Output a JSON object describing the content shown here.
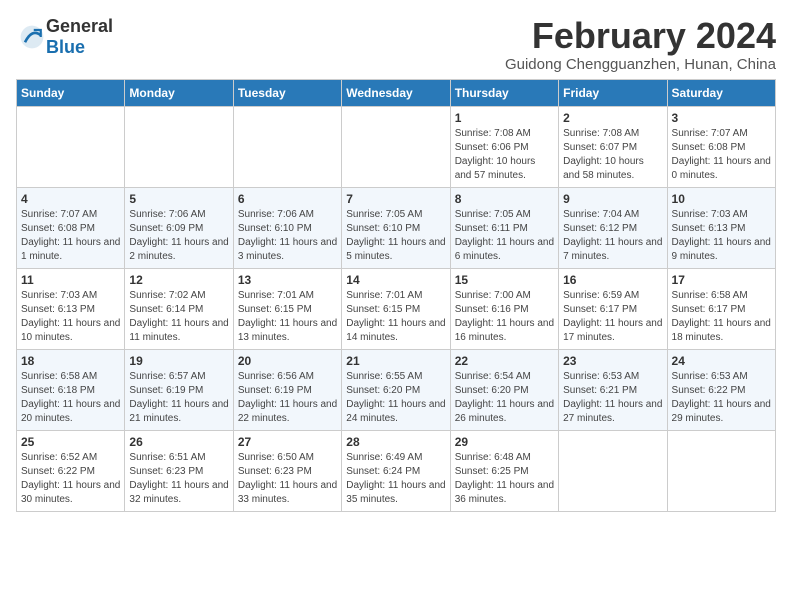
{
  "logo": {
    "general": "General",
    "blue": "Blue"
  },
  "title": "February 2024",
  "location": "Guidong Chengguanzhen, Hunan, China",
  "headers": [
    "Sunday",
    "Monday",
    "Tuesday",
    "Wednesday",
    "Thursday",
    "Friday",
    "Saturday"
  ],
  "rows": [
    [
      {
        "day": "",
        "info": ""
      },
      {
        "day": "",
        "info": ""
      },
      {
        "day": "",
        "info": ""
      },
      {
        "day": "",
        "info": ""
      },
      {
        "day": "1",
        "info": "Sunrise: 7:08 AM\nSunset: 6:06 PM\nDaylight: 10 hours and 57 minutes."
      },
      {
        "day": "2",
        "info": "Sunrise: 7:08 AM\nSunset: 6:07 PM\nDaylight: 10 hours and 58 minutes."
      },
      {
        "day": "3",
        "info": "Sunrise: 7:07 AM\nSunset: 6:08 PM\nDaylight: 11 hours and 0 minutes."
      }
    ],
    [
      {
        "day": "4",
        "info": "Sunrise: 7:07 AM\nSunset: 6:08 PM\nDaylight: 11 hours and 1 minute."
      },
      {
        "day": "5",
        "info": "Sunrise: 7:06 AM\nSunset: 6:09 PM\nDaylight: 11 hours and 2 minutes."
      },
      {
        "day": "6",
        "info": "Sunrise: 7:06 AM\nSunset: 6:10 PM\nDaylight: 11 hours and 3 minutes."
      },
      {
        "day": "7",
        "info": "Sunrise: 7:05 AM\nSunset: 6:10 PM\nDaylight: 11 hours and 5 minutes."
      },
      {
        "day": "8",
        "info": "Sunrise: 7:05 AM\nSunset: 6:11 PM\nDaylight: 11 hours and 6 minutes."
      },
      {
        "day": "9",
        "info": "Sunrise: 7:04 AM\nSunset: 6:12 PM\nDaylight: 11 hours and 7 minutes."
      },
      {
        "day": "10",
        "info": "Sunrise: 7:03 AM\nSunset: 6:13 PM\nDaylight: 11 hours and 9 minutes."
      }
    ],
    [
      {
        "day": "11",
        "info": "Sunrise: 7:03 AM\nSunset: 6:13 PM\nDaylight: 11 hours and 10 minutes."
      },
      {
        "day": "12",
        "info": "Sunrise: 7:02 AM\nSunset: 6:14 PM\nDaylight: 11 hours and 11 minutes."
      },
      {
        "day": "13",
        "info": "Sunrise: 7:01 AM\nSunset: 6:15 PM\nDaylight: 11 hours and 13 minutes."
      },
      {
        "day": "14",
        "info": "Sunrise: 7:01 AM\nSunset: 6:15 PM\nDaylight: 11 hours and 14 minutes."
      },
      {
        "day": "15",
        "info": "Sunrise: 7:00 AM\nSunset: 6:16 PM\nDaylight: 11 hours and 16 minutes."
      },
      {
        "day": "16",
        "info": "Sunrise: 6:59 AM\nSunset: 6:17 PM\nDaylight: 11 hours and 17 minutes."
      },
      {
        "day": "17",
        "info": "Sunrise: 6:58 AM\nSunset: 6:17 PM\nDaylight: 11 hours and 18 minutes."
      }
    ],
    [
      {
        "day": "18",
        "info": "Sunrise: 6:58 AM\nSunset: 6:18 PM\nDaylight: 11 hours and 20 minutes."
      },
      {
        "day": "19",
        "info": "Sunrise: 6:57 AM\nSunset: 6:19 PM\nDaylight: 11 hours and 21 minutes."
      },
      {
        "day": "20",
        "info": "Sunrise: 6:56 AM\nSunset: 6:19 PM\nDaylight: 11 hours and 22 minutes."
      },
      {
        "day": "21",
        "info": "Sunrise: 6:55 AM\nSunset: 6:20 PM\nDaylight: 11 hours and 24 minutes."
      },
      {
        "day": "22",
        "info": "Sunrise: 6:54 AM\nSunset: 6:20 PM\nDaylight: 11 hours and 26 minutes."
      },
      {
        "day": "23",
        "info": "Sunrise: 6:53 AM\nSunset: 6:21 PM\nDaylight: 11 hours and 27 minutes."
      },
      {
        "day": "24",
        "info": "Sunrise: 6:53 AM\nSunset: 6:22 PM\nDaylight: 11 hours and 29 minutes."
      }
    ],
    [
      {
        "day": "25",
        "info": "Sunrise: 6:52 AM\nSunset: 6:22 PM\nDaylight: 11 hours and 30 minutes."
      },
      {
        "day": "26",
        "info": "Sunrise: 6:51 AM\nSunset: 6:23 PM\nDaylight: 11 hours and 32 minutes."
      },
      {
        "day": "27",
        "info": "Sunrise: 6:50 AM\nSunset: 6:23 PM\nDaylight: 11 hours and 33 minutes."
      },
      {
        "day": "28",
        "info": "Sunrise: 6:49 AM\nSunset: 6:24 PM\nDaylight: 11 hours and 35 minutes."
      },
      {
        "day": "29",
        "info": "Sunrise: 6:48 AM\nSunset: 6:25 PM\nDaylight: 11 hours and 36 minutes."
      },
      {
        "day": "",
        "info": ""
      },
      {
        "day": "",
        "info": ""
      }
    ]
  ]
}
